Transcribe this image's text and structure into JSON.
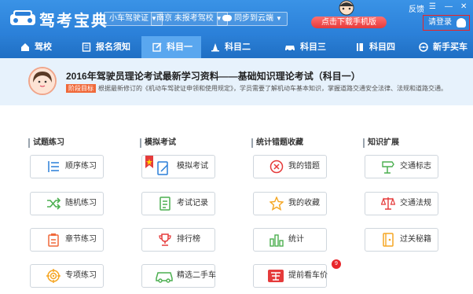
{
  "header": {
    "app_title": "驾考宝典",
    "license_dropdown": "小车驾驶证",
    "school_dropdown": "南京 未报考驾校",
    "cloud_dropdown": "同步到云端",
    "download_button": "点击下载手机版",
    "feedback": "反馈",
    "login_button": "请登录"
  },
  "nav": {
    "items": [
      {
        "label": "驾校",
        "icon": "school-icon"
      },
      {
        "label": "报名须知",
        "icon": "document-icon"
      },
      {
        "label": "科目一",
        "icon": "edit-icon"
      },
      {
        "label": "科目二",
        "icon": "cone-icon"
      },
      {
        "label": "科目三",
        "icon": "car-icon"
      },
      {
        "label": "科目四",
        "icon": "book-icon"
      },
      {
        "label": "新手买车",
        "icon": "steering-wheel-icon"
      }
    ],
    "active_index": 2
  },
  "banner": {
    "title": "2016年驾驶员理论考试最新学习资料——基础知识理论考试（科目一）",
    "badge": "阶段目标",
    "description": "根据最新修订的《机动车驾驶证申领和使用规定》，学员需要了解机动车基本知识，掌握道路交通安全法律、法规和道路交通。"
  },
  "sections": [
    {
      "title": "试题练习",
      "tiles": [
        "顺序练习",
        "随机练习",
        "章节练习",
        "专项练习"
      ]
    },
    {
      "title": "模拟考试",
      "tiles": [
        "模拟考试",
        "考试记录",
        "排行榜",
        "精选二手车"
      ]
    },
    {
      "title": "统计错题收藏",
      "tiles": [
        "我的错题",
        "我的收藏",
        "统计",
        "提前看车价"
      ]
    },
    {
      "title": "知识扩展",
      "tiles": [
        "交通标志",
        "交通法规",
        "过关秘籍"
      ]
    }
  ],
  "notification_count": "9",
  "colors": {
    "header_blue": "#2a7fd8",
    "nav_active": "#5aa7ef",
    "accent_red": "#e53b3b",
    "icon_blue": "#2a7fd8",
    "icon_green": "#4caf50",
    "icon_orange": "#f0693a"
  }
}
